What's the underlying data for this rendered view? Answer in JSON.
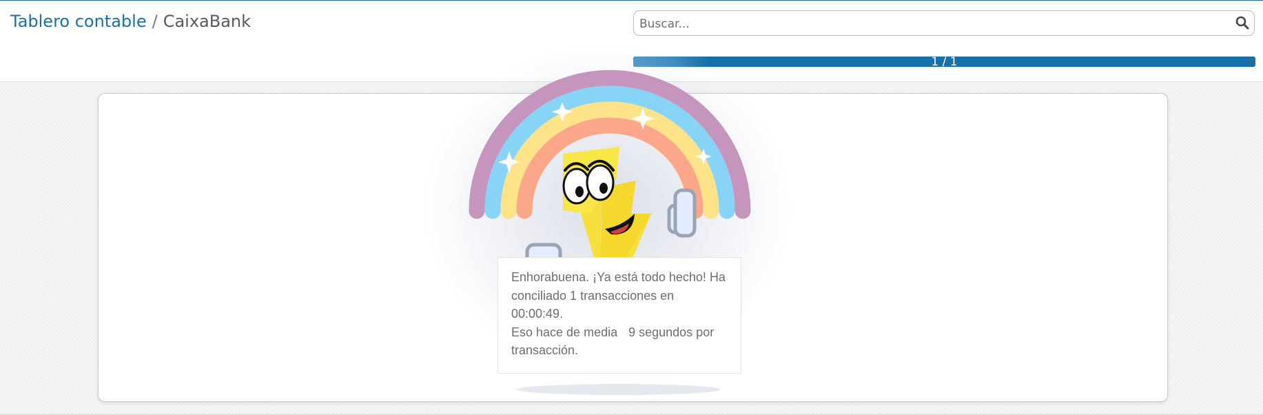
{
  "breadcrumb": {
    "parent": "Tablero contable",
    "separator": "/",
    "current": "CaixaBank"
  },
  "search": {
    "placeholder": "Buscar...",
    "value": ""
  },
  "pager": {
    "label": "1 / 1",
    "progress": 1.0
  },
  "message": {
    "line1": "Enhorabuena. ¡Ya está todo hecho! Ha",
    "line2": "conciliado 1 transacciones en 00:00:49.",
    "line3_part1": "Eso hace de media",
    "line3_part2": "9 segundos por",
    "line4": "transacción."
  },
  "illustration": {
    "subject": "rainbow-lightning-mascot",
    "colors": {
      "rainbow_outer": "#c595be",
      "rainbow_blue": "#87d4f6",
      "rainbow_yellow": "#fee38a",
      "rainbow_inner": "#fca789",
      "bolt": "#f7e03d",
      "glove": "#e4ecff",
      "glove_outline": "#9aa4b2"
    }
  },
  "colors": {
    "accent": "#1e6fa6",
    "pager_bar": "#1970a8",
    "background": "#f6f6f6"
  }
}
